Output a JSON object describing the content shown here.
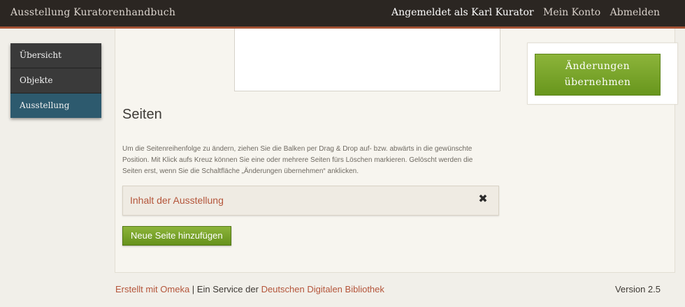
{
  "header": {
    "site_title": "Ausstellung Kuratorenhandbuch",
    "logged_in_as": "Angemeldet als Karl Kurator",
    "my_account": "Mein Konto",
    "logout": "Abmelden"
  },
  "sidebar": {
    "items": [
      {
        "label": "Übersicht"
      },
      {
        "label": "Objekte"
      },
      {
        "label": "Ausstellung"
      }
    ],
    "active_item": "Ausstellung"
  },
  "main": {
    "section_title": "Seiten",
    "help_text": "Um die Seitenreihenfolge zu ändern, ziehen Sie die Balken per Drag & Drop auf- bzw. abwärts in die gewünschte Position. Mit Klick aufs Kreuz können Sie eine oder mehrere Seiten fürs Löschen markieren. Gelöscht werden die Seiten erst, wenn Sie die Schaltfläche „Änderungen übernehmen“ anklicken.",
    "pages": [
      {
        "label": "Inhalt der Ausstellung",
        "icon": "close-icon"
      }
    ],
    "add_page_button": "Neue Seite hinzufügen"
  },
  "save_panel": {
    "save_button_line1": "Änderungen",
    "save_button_line2": "übernehmen"
  },
  "footer": {
    "made_with": "Erstellt mit Omeka",
    "separator": " | Ein Service der ",
    "ddb": "Deutschen Digitalen Bibliothek",
    "version": "Version 2.5"
  },
  "colors": {
    "topbar_bg": "#2b2622",
    "accent_rust": "#a55335",
    "link_rust": "#b4553a",
    "active_nav": "#2d5a6e",
    "button_green": "#7aa52b"
  }
}
